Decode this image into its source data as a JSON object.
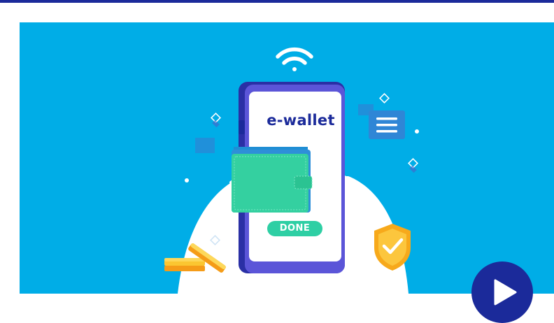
{
  "banner": {
    "wallet_title": "e-wallet",
    "done_label": "DONE"
  },
  "icons": {
    "wifi": "wifi-icon",
    "menu": "menu-list-icon",
    "shield": "shield-check-icon",
    "wallet": "wallet-icon",
    "coins": "coins-icon",
    "play": "play-icon"
  },
  "colors": {
    "top_bar": "#1b2a9a",
    "banner_background": "#00ade7",
    "phone_body": "#2a2fa5",
    "screen": "#ffffff",
    "wallet": "#34d0a0",
    "done_badge": "#2ecfa4",
    "shield": "#f7a91b",
    "coins": "#f9b823",
    "play_button": "#1b2a9a"
  }
}
